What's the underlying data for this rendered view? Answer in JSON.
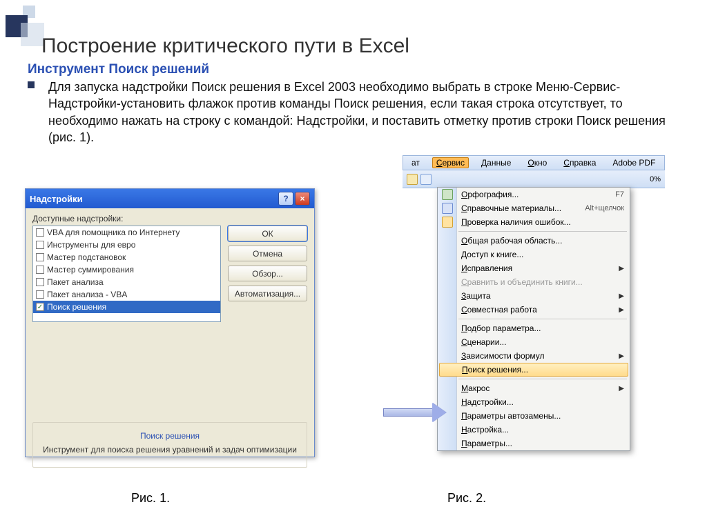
{
  "slide": {
    "title": "Построение критического пути в Excel",
    "subtitle": "Инструмент Поиск решений",
    "body": "Для запуска надстройки Поиск решения в Excel 2003 необходимо выбрать в строке Меню-Сервис-Надстройки-установить флажок против команды Поиск решения, если такая строка отсутствует, то необходимо нажать на строку с командой: Надстройки, и поставить отметку против строки Поиск решения (рис. 1).",
    "fig1": "Рис. 1.",
    "fig2": "Рис. 2."
  },
  "dialog": {
    "title": "Надстройки",
    "available_label": "Доступные надстройки:",
    "addins": [
      {
        "label": "VBA для помощника по Интернету",
        "checked": false
      },
      {
        "label": "Инструменты для евро",
        "checked": false
      },
      {
        "label": "Мастер подстановок",
        "checked": false
      },
      {
        "label": "Мастер суммирования",
        "checked": false
      },
      {
        "label": "Пакет анализа",
        "checked": false
      },
      {
        "label": "Пакет анализа - VBA",
        "checked": false
      },
      {
        "label": "Поиск решения",
        "checked": true,
        "selected": true
      }
    ],
    "buttons": {
      "ok": "ОК",
      "cancel": "Отмена",
      "browse": "Обзор...",
      "automation": "Автоматизация..."
    },
    "desc_title": "Поиск решения",
    "desc_text": "Инструмент для поиска решения уравнений и задач оптимизации"
  },
  "excel": {
    "menubar": {
      "format": "ат",
      "service": "Сервис",
      "data": "Данные",
      "window": "Окно",
      "help": "Справка",
      "adobe": "Adobe PDF"
    },
    "toolbar": {
      "zoom": "0%"
    },
    "menu": [
      {
        "kind": "item",
        "label": "Орфография...",
        "shortcut": "F7",
        "icon": "abc"
      },
      {
        "kind": "item",
        "label": "Справочные материалы...",
        "shortcut": "Alt+щелчок",
        "icon": "book"
      },
      {
        "kind": "item",
        "label": "Проверка наличия ошибок...",
        "icon": "warn"
      },
      {
        "kind": "sep"
      },
      {
        "kind": "item",
        "label": "Общая рабочая область..."
      },
      {
        "kind": "item",
        "label": "Доступ к книге..."
      },
      {
        "kind": "item",
        "label": "Исправления",
        "submenu": true
      },
      {
        "kind": "item",
        "label": "Сравнить и объединить книги...",
        "disabled": true
      },
      {
        "kind": "item",
        "label": "Защита",
        "submenu": true
      },
      {
        "kind": "item",
        "label": "Совместная работа",
        "submenu": true
      },
      {
        "kind": "sep"
      },
      {
        "kind": "item",
        "label": "Подбор параметра..."
      },
      {
        "kind": "item",
        "label": "Сценарии..."
      },
      {
        "kind": "item",
        "label": "Зависимости формул",
        "submenu": true
      },
      {
        "kind": "item",
        "label": "Поиск решения...",
        "highlight": true
      },
      {
        "kind": "sep"
      },
      {
        "kind": "item",
        "label": "Макрос",
        "submenu": true
      },
      {
        "kind": "item",
        "label": "Надстройки..."
      },
      {
        "kind": "item",
        "label": "Параметры автозамены..."
      },
      {
        "kind": "item",
        "label": "Настройка..."
      },
      {
        "kind": "item",
        "label": "Параметры..."
      }
    ]
  }
}
